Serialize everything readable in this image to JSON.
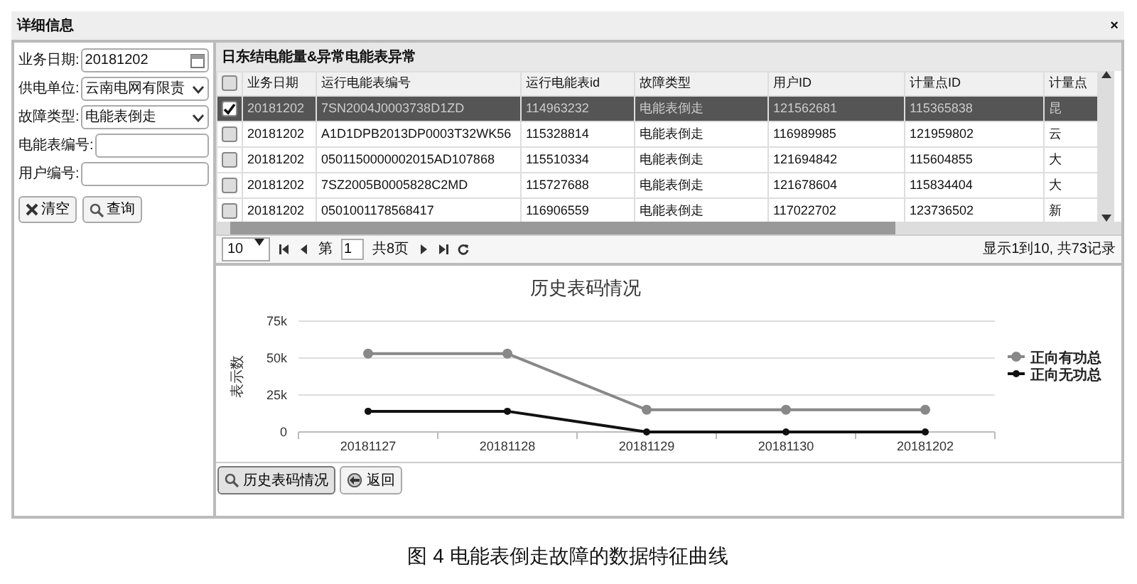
{
  "window": {
    "title": "详细信息",
    "close": "×"
  },
  "form": {
    "fields": [
      {
        "kind": "date",
        "label": "业务日期:",
        "value": "20181202"
      },
      {
        "kind": "select",
        "label": "供电单位:",
        "value": "云南电网有限责"
      },
      {
        "kind": "select",
        "label": "故障类型:",
        "value": "电能表倒走"
      },
      {
        "kind": "text",
        "label": "电能表编号:"
      },
      {
        "kind": "text",
        "label": "用户编号:"
      }
    ],
    "buttons": [
      {
        "kind": "clear",
        "label": "清空"
      },
      {
        "kind": "search",
        "label": "查询"
      }
    ]
  },
  "grid": {
    "title": "日东结电能量&异常电能表异常",
    "all_selected": false,
    "columns": [
      "业务日期",
      "运行电能表编号",
      "运行电能表id",
      "故障类型",
      "用户ID",
      "计量点ID",
      "计量点"
    ],
    "rows": [
      {
        "selected": true,
        "cells": [
          "20181202",
          "7SN2004J0003738D1ZD",
          "114963232",
          "电能表倒走",
          "121562681",
          "115365838",
          "昆"
        ]
      },
      {
        "selected": false,
        "cells": [
          "20181202",
          "A1D1DPB2013DP0003T32WK56",
          "115328814",
          "电能表倒走",
          "116989985",
          "121959802",
          "云"
        ]
      },
      {
        "selected": false,
        "cells": [
          "20181202",
          "0501150000002015AD107868",
          "115510334",
          "电能表倒走",
          "121694842",
          "115604855",
          "大"
        ]
      },
      {
        "selected": false,
        "cells": [
          "20181202",
          "7SZ2005B0005828C2MD",
          "115727688",
          "电能表倒走",
          "121678604",
          "115834404",
          "大"
        ]
      },
      {
        "selected": false,
        "cells": [
          "20181202",
          "0501001178568417",
          "116906559",
          "电能表倒走",
          "117022702",
          "123736502",
          "新"
        ]
      }
    ],
    "pager": {
      "page_size": "10",
      "page_prefix": "第",
      "page": "1",
      "page_total": "共8页",
      "summary": "显示1到10, 共73记录"
    }
  },
  "chart": {
    "chart_data": {
      "type": "line",
      "title": "历史表码情况",
      "ylabel": "表示数",
      "categories": [
        "20181127",
        "20181128",
        "20181129",
        "20181130",
        "20181202"
      ],
      "series": [
        {
          "name": "正向有功总",
          "color": "#888888",
          "marker": "circle",
          "values": [
            53000,
            53000,
            15000,
            15000,
            15000
          ]
        },
        {
          "name": "正向无功总",
          "color": "#111111",
          "marker": "circle",
          "values": [
            14000,
            14000,
            0,
            0,
            0
          ]
        }
      ],
      "legend": "right",
      "ylim": [
        0,
        75000
      ],
      "yticks": [
        {
          "value": 0,
          "label": "0"
        },
        {
          "value": 25000,
          "label": "25k"
        },
        {
          "value": 50000,
          "label": "50k"
        },
        {
          "value": 75000,
          "label": "75k"
        }
      ]
    }
  },
  "bottom_buttons": [
    {
      "kind": "search",
      "label": "历史表码情况",
      "selected": true
    },
    {
      "kind": "back",
      "label": "返回",
      "selected": false
    }
  ],
  "caption": "图 4 电能表倒走故障的数据特征曲线"
}
